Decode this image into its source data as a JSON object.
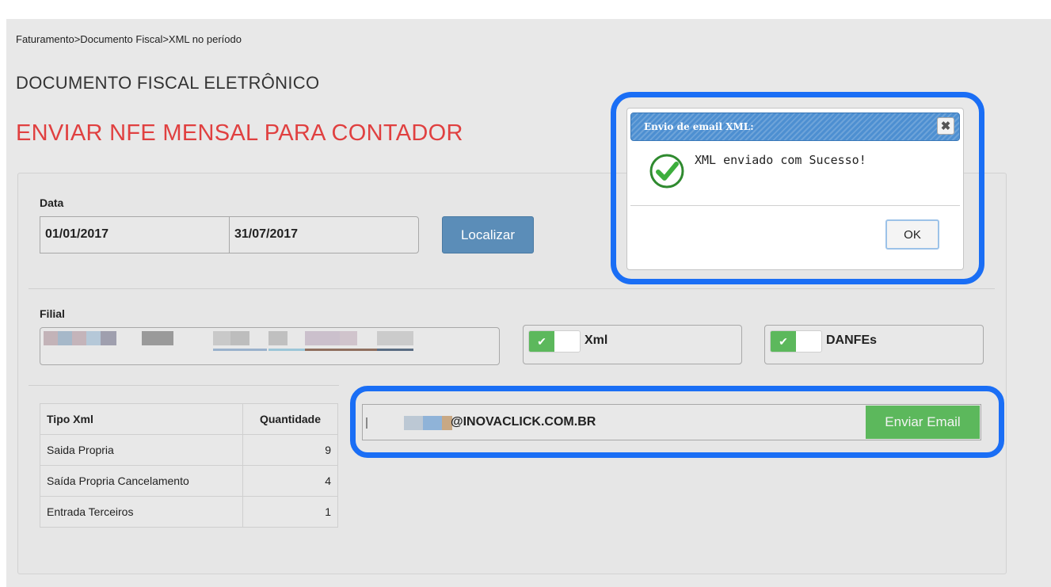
{
  "breadcrumb": "Faturamento>Documento Fiscal>XML no período",
  "subtitle": "DOCUMENTO FISCAL ELETRÔNICO",
  "title": "ENVIAR NFE MENSAL PARA CONTADOR",
  "form": {
    "date_label": "Data",
    "date_start": "01/01/2017",
    "date_end": "31/07/2017",
    "find_button": "Localizar",
    "branch_label": "Filial",
    "xml_check_label": "Xml",
    "danfe_check_label": "DANFEs",
    "xml_checked": true,
    "danfe_checked": true,
    "check_glyph": "✔"
  },
  "table": {
    "headers": [
      "Tipo Xml",
      "Quantidade"
    ],
    "rows": [
      [
        "Saida Propria",
        "9"
      ],
      [
        "Saída Propria Cancelamento",
        "4"
      ],
      [
        "Entrada Terceiros",
        "1"
      ]
    ]
  },
  "email": {
    "value_visible": "@INOVACLICK.COM.BR",
    "send_button": "Enviar Email"
  },
  "dialog": {
    "title": "Envio de email XML:",
    "close_glyph": "✖",
    "message": "XML enviado com Sucesso!",
    "ok_button": "OK"
  },
  "colors": {
    "title": "#e04040",
    "primary_button": "#5b8db8",
    "success": "#5cb85c",
    "highlight": "#1a6ef5",
    "dialog_header": "#4d8fd1"
  }
}
